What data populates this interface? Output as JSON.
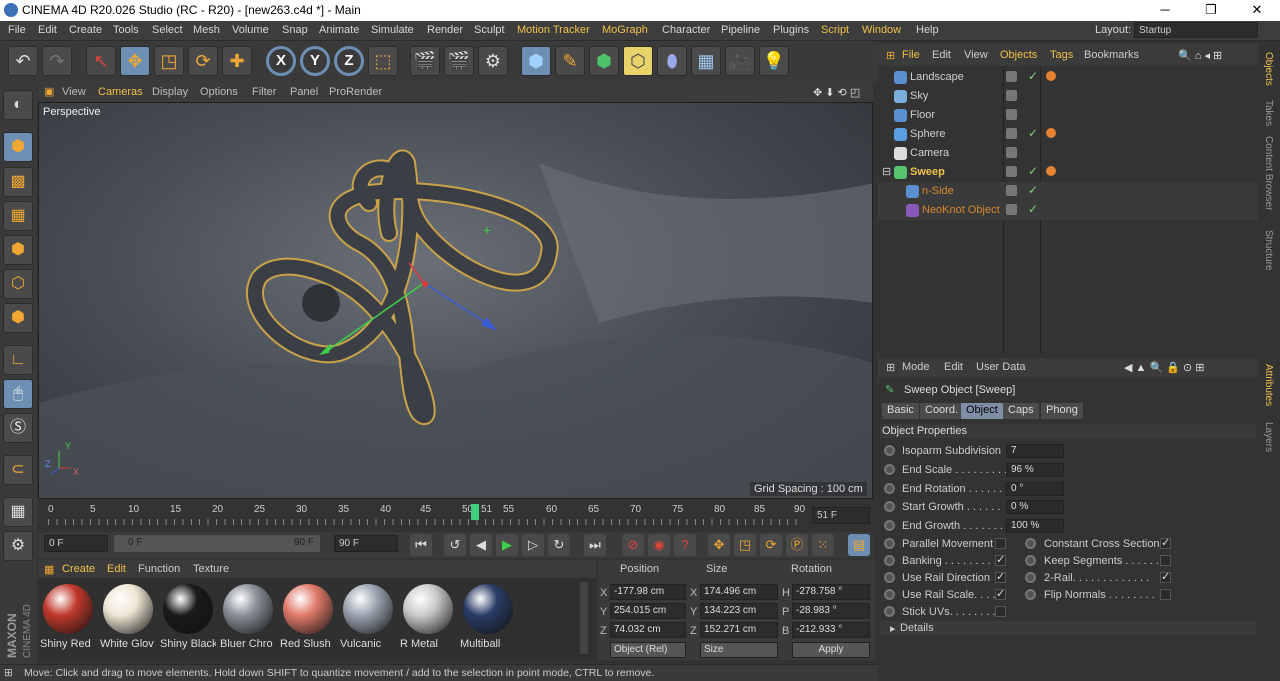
{
  "window": {
    "title": "CINEMA 4D R20.026 Studio (RC - R20) - [new263.c4d *] - Main",
    "min": "─",
    "max": "❐",
    "close": "✕"
  },
  "menubar": {
    "items": [
      "File",
      "Edit",
      "Create",
      "Tools",
      "Select",
      "Mesh",
      "Volume",
      "Snap",
      "Animate",
      "Simulate",
      "Render",
      "Sculpt",
      "Motion Tracker",
      "MoGraph",
      "Character",
      "Pipeline",
      "Plugins",
      "Script",
      "Window",
      "Help"
    ],
    "layout_label": "Layout:",
    "layout_value": "Startup"
  },
  "viewport": {
    "menu": [
      "View",
      "Cameras",
      "Display",
      "Options",
      "Filter",
      "Panel",
      "ProRender"
    ],
    "label": "Perspective",
    "grid_spacing": "Grid Spacing : 100 cm",
    "axis_y": "Y",
    "axis_z": "Z",
    "axis_x": "X"
  },
  "timeline": {
    "ticks": [
      "0",
      "5",
      "10",
      "15",
      "20",
      "25",
      "30",
      "35",
      "40",
      "45",
      "50",
      "51",
      "55",
      "60",
      "65",
      "70",
      "75",
      "80",
      "85",
      "90"
    ],
    "frame_field": "51 F",
    "start": "0 F",
    "range_start": "0 F",
    "range_end": "90 F",
    "end": "90 F"
  },
  "materials": {
    "menu": [
      "Create",
      "Edit",
      "Function",
      "Texture"
    ],
    "items": [
      {
        "name": "Shiny Red",
        "color": "#c0392b"
      },
      {
        "name": "White Glov",
        "color": "#eee6d4"
      },
      {
        "name": "Shiny Black",
        "color": "#1a1a1a"
      },
      {
        "name": "Bluer Chro",
        "color": "#8a9098"
      },
      {
        "name": "Red Slush",
        "color": "#e07a6a"
      },
      {
        "name": "Vulcanic",
        "color": "#9aa4b0"
      },
      {
        "name": "R Metal",
        "color": "#c9c9c9"
      },
      {
        "name": "Multiball",
        "color": "#2a3d66"
      }
    ]
  },
  "coords": {
    "headers": [
      "Position",
      "Size",
      "Rotation"
    ],
    "rows": [
      {
        "a": "X",
        "pos": "-177.98 cm",
        "b": "X",
        "size": "174.496 cm",
        "c": "H",
        "rot": "-278.758 °"
      },
      {
        "a": "Y",
        "pos": "254.015 cm",
        "b": "Y",
        "size": "134.223 cm",
        "c": "P",
        "rot": "-28.983 °"
      },
      {
        "a": "Z",
        "pos": "74.032 cm",
        "b": "Z",
        "size": "152.271 cm",
        "c": "B",
        "rot": "-212.933 °"
      }
    ],
    "mode": "Object (Rel)",
    "size_mode": "Size",
    "apply": "Apply"
  },
  "status": "Move: Click and drag to move elements. Hold down SHIFT to quantize movement / add to the selection in point mode, CTRL to remove.",
  "objects": {
    "menu": [
      "File",
      "Edit",
      "View",
      "Objects",
      "Tags",
      "Bookmarks"
    ],
    "items": [
      {
        "name": "Landscape",
        "icon": "#5a8fd0",
        "check": "✓",
        "tag": true
      },
      {
        "name": "Sky",
        "icon": "#7aaedc",
        "check": "",
        "tag": false
      },
      {
        "name": "Floor",
        "icon": "#5a8fd0",
        "check": "",
        "tag": false
      },
      {
        "name": "Sphere",
        "icon": "#5aa0e0",
        "check": "✓",
        "tag": true
      },
      {
        "name": "Camera",
        "icon": "#ddd",
        "check": "",
        "tag": false
      },
      {
        "name": "Sweep",
        "icon": "#57c46e",
        "check": "✓",
        "tag": true
      },
      {
        "name": "n-Side",
        "icon": "#5a8fd0",
        "check": "✓",
        "tag": false
      },
      {
        "name": "NeoKnot Object",
        "icon": "#8a5ab8",
        "check": "✓",
        "tag": false
      }
    ]
  },
  "attributes": {
    "menu": [
      "Mode",
      "Edit",
      "User Data"
    ],
    "object_title": "Sweep Object [Sweep]",
    "tabs": [
      "Basic",
      "Coord.",
      "Object",
      "Caps",
      "Phong"
    ],
    "section": "Object Properties",
    "props": [
      {
        "label": "Isoparm Subdivision",
        "value": "7"
      },
      {
        "label": "End Scale . . . . . . . . .",
        "value": "96 %"
      },
      {
        "label": "End Rotation . . . . . .",
        "value": "0 °"
      },
      {
        "label": "Start Growth . . . . . .",
        "value": "0 %"
      },
      {
        "label": "End Growth . . . . . . .",
        "value": "100 %"
      }
    ],
    "checks_left": [
      {
        "label": "Parallel Movement",
        "check": ""
      },
      {
        "label": "Banking . . . . . . . . .",
        "check": "✓"
      },
      {
        "label": "Use Rail Direction",
        "check": "✓"
      },
      {
        "label": "Use Rail Scale. . . . .",
        "check": "✓"
      },
      {
        "label": "Stick UVs. . . . . . . .",
        "check": ""
      }
    ],
    "checks_right": [
      {
        "label": "Constant Cross Section",
        "check": "✓"
      },
      {
        "label": "Keep Segments . . . . . .",
        "check": ""
      },
      {
        "label": "2-Rail. . . . . . . . . . . . .",
        "check": "✓"
      },
      {
        "label": "Flip Normals . . . . . . . .",
        "check": ""
      }
    ],
    "details": "Details"
  },
  "side_tabs": [
    "Objects",
    "Takes",
    "Content Browser",
    "Structure",
    "Attributes",
    "Layers"
  ],
  "branding": {
    "maxon": "MAXON",
    "c4d": "CINEMA 4D"
  }
}
